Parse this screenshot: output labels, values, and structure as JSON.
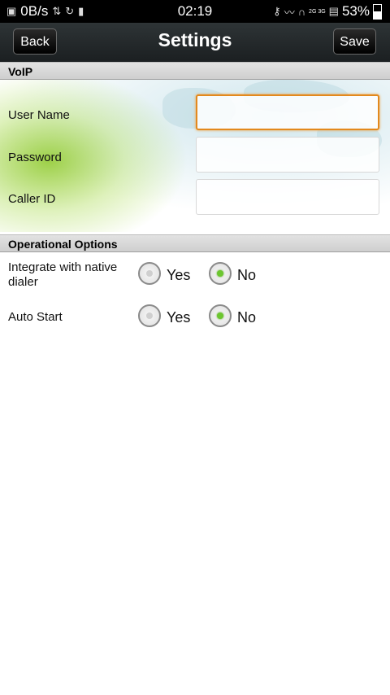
{
  "status_bar": {
    "net_speed": "0B/s",
    "time": "02:19",
    "network_labels": "2G 3G",
    "battery": "53%",
    "left_icons": [
      "image-icon",
      "data-sync-icon",
      "sync-icon",
      "n-icon"
    ],
    "right_icons": [
      "key-icon",
      "signal-wave-icon",
      "headphones-icon",
      "signal-bars-icon"
    ]
  },
  "title_bar": {
    "back_label": "Back",
    "title": "Settings",
    "save_label": "Save"
  },
  "voip": {
    "header": "VoIP",
    "fields": [
      {
        "label": "User Name",
        "value": "",
        "focused": true
      },
      {
        "label": "Password",
        "value": ""
      },
      {
        "label": "Caller ID",
        "value": ""
      }
    ]
  },
  "operational": {
    "header": "Operational Options",
    "options": [
      {
        "label": "Integrate with native dialer",
        "yes": "Yes",
        "no": "No",
        "selected": "No"
      },
      {
        "label": "Auto Start",
        "yes": "Yes",
        "no": "No",
        "selected": "No"
      }
    ]
  },
  "colors": {
    "focus_border": "#e3891d",
    "radio_selected": "#6cc62f",
    "title_bar": "#1b1f21"
  }
}
